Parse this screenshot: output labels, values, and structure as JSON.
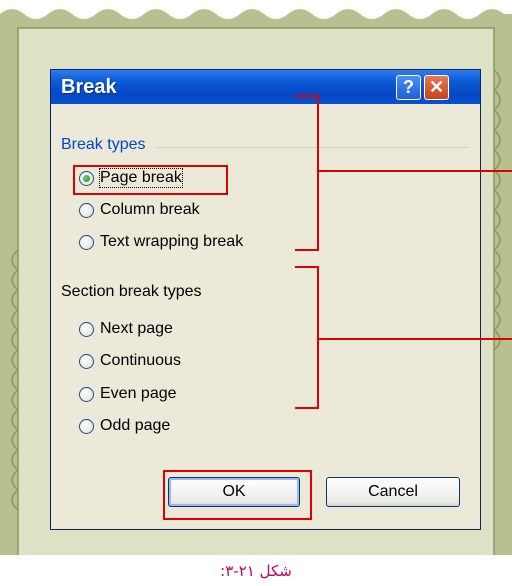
{
  "dialog": {
    "title": "Break",
    "help_button": "?",
    "close_button": "✕"
  },
  "break_types": {
    "label": "Break types",
    "options": [
      {
        "label": "Page break",
        "selected": true
      },
      {
        "label": "Column break",
        "selected": false
      },
      {
        "label": "Text wrapping break",
        "selected": false
      }
    ]
  },
  "section_break_types": {
    "label": "Section break types",
    "options": [
      {
        "label": "Next page",
        "selected": false
      },
      {
        "label": "Continuous",
        "selected": false
      },
      {
        "label": "Even page",
        "selected": false
      },
      {
        "label": "Odd page",
        "selected": false
      }
    ]
  },
  "buttons": {
    "ok": "OK",
    "cancel": "Cancel"
  },
  "caption": "شکل ۲۱-۳:",
  "colors": {
    "frame_green": "#c2cba0",
    "frame_inner": "#e3e7d0",
    "title_blue": "#0a50d0",
    "annotation_red": "#e00000",
    "caption_color": "#c0006a"
  }
}
